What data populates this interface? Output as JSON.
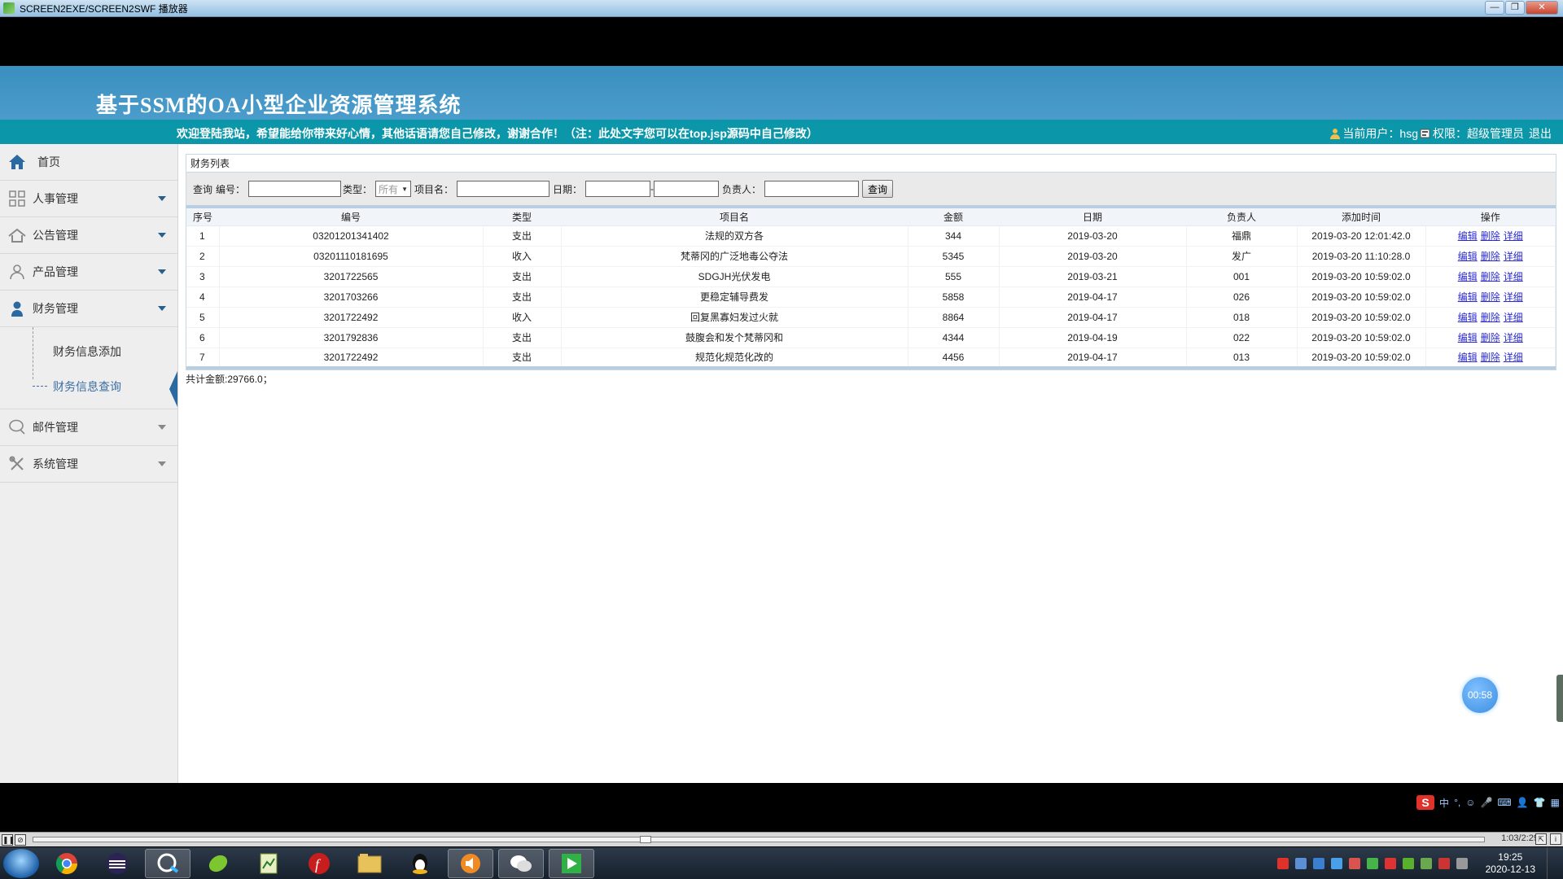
{
  "window": {
    "title": "SCREEN2EXE/SCREEN2SWF 播放器",
    "buttons": [
      "—",
      "❐",
      "✕"
    ]
  },
  "app": {
    "system_title": "基于SSM的OA小型企业资源管理系统",
    "welcome": "欢迎登陆我站，希望能给你带来好心情，其他话语请您自己修改，谢谢合作！（注：此处文字您可以在top.jsp源码中自己修改）",
    "current_user_label": "当前用户：hsg",
    "role_label": "权限：超级管理员",
    "logout": "退出"
  },
  "sidebar": {
    "home": "首页",
    "menus": [
      {
        "label": "人事管理",
        "icon": "grid-icon"
      },
      {
        "label": "公告管理",
        "icon": "house-icon"
      },
      {
        "label": "产品管理",
        "icon": "person-outline-icon"
      },
      {
        "label": "财务管理",
        "icon": "person-icon"
      }
    ],
    "finance_sub": [
      "财务信息添加",
      "财务信息查询"
    ],
    "menus_after": [
      {
        "label": "邮件管理",
        "icon": "chat-icon"
      },
      {
        "label": "系统管理",
        "icon": "tools-icon"
      }
    ]
  },
  "panel": {
    "title": "财务列表"
  },
  "search": {
    "query_label": "查询",
    "code_label": "编号：",
    "type_label": "类型：",
    "type_selected": "所有",
    "item_label": "项目名：",
    "date_label": "日期：",
    "date_sep": "-",
    "owner_label": "负责人：",
    "button": "查询"
  },
  "table": {
    "headers": [
      "序号",
      "编号",
      "类型",
      "项目名",
      "金额",
      "日期",
      "负责人",
      "添加时间",
      "操作"
    ],
    "rows": [
      [
        "1",
        "03201201341402",
        "支出",
        "法规的双方各",
        "344",
        "2019-03-20",
        "福鼎",
        "2019-03-20 12:01:42.0"
      ],
      [
        "2",
        "03201110181695",
        "收入",
        "梵蒂冈的广泛地毒公夺法",
        "5345",
        "2019-03-20",
        "发广",
        "2019-03-20 11:10:28.0"
      ],
      [
        "3",
        "3201722565",
        "支出",
        "SDGJH光伏发电",
        "555",
        "2019-03-21",
        "001",
        "2019-03-20 10:59:02.0"
      ],
      [
        "4",
        "3201703266",
        "支出",
        "更稳定辅导费发",
        "5858",
        "2019-04-17",
        "026",
        "2019-03-20 10:59:02.0"
      ],
      [
        "5",
        "3201722492",
        "收入",
        "回复黑寡妇发过火就",
        "8864",
        "2019-04-17",
        "018",
        "2019-03-20 10:59:02.0"
      ],
      [
        "6",
        "3201792836",
        "支出",
        "鼓腹会和发个梵蒂冈和",
        "4344",
        "2019-04-19",
        "022",
        "2019-03-20 10:59:02.0"
      ],
      [
        "7",
        "3201722492",
        "支出",
        "规范化规范化改的",
        "4456",
        "2019-04-17",
        "013",
        "2019-03-20 10:59:02.0"
      ]
    ],
    "ops": [
      "编辑",
      "删除",
      "详细"
    ]
  },
  "total": "共计金额:29766.0；",
  "overlay": {
    "timer": "00:58"
  },
  "player": {
    "time": "1:03/2:29",
    "ime_logo": "S",
    "ime_lang": "中"
  },
  "taskbar": {
    "clock_time": "19:25",
    "clock_date": "2020-12-13"
  }
}
